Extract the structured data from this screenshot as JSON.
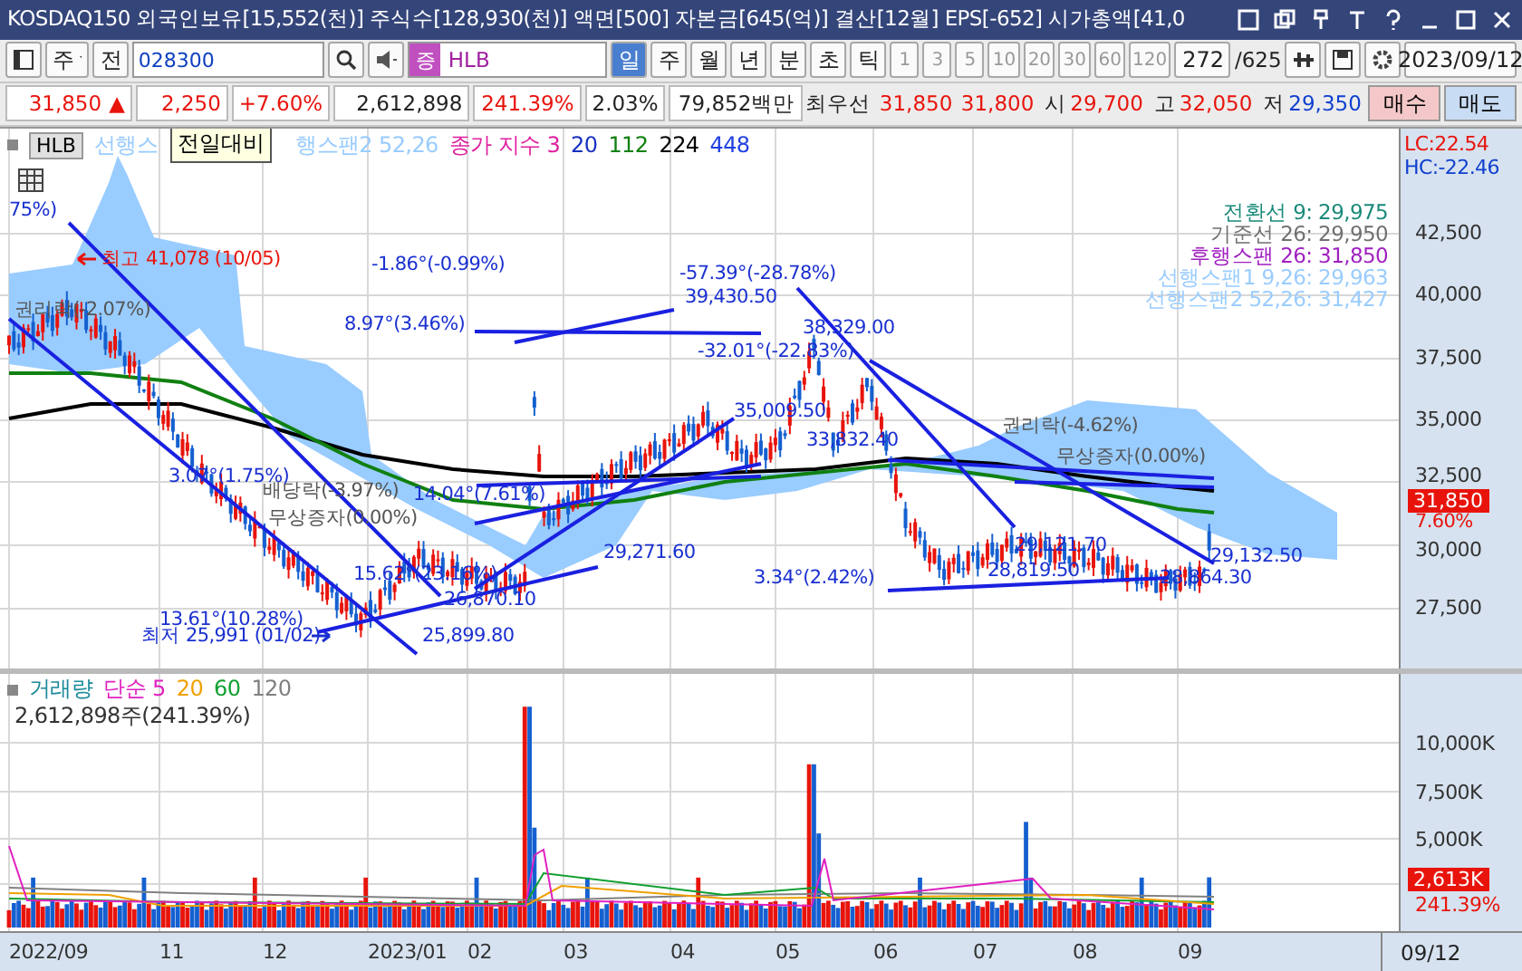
{
  "title_bar": {
    "title": "KOSDAQ150 외국인보유[15,552(천)] 주식수[128,930(천)] 액면[500] 자본금[645(억)] 결산[12월] EPS[-652] 시가총액[41,0"
  },
  "toolbar": {
    "market": "주",
    "prev_button": "전",
    "code": "028300",
    "stock_badge": "증",
    "stock_name": "HLB",
    "periods": [
      {
        "label": "일",
        "selected": true
      },
      {
        "label": "주",
        "selected": false
      },
      {
        "label": "월",
        "selected": false
      },
      {
        "label": "년",
        "selected": false
      }
    ],
    "intraday": [
      "분",
      "초",
      "틱"
    ],
    "minutes": [
      "1",
      "3",
      "5",
      "10",
      "20",
      "30",
      "60",
      "120"
    ],
    "count": "272",
    "total": "/625",
    "date": "2023/09/12"
  },
  "quote": {
    "cells": [
      {
        "text": "31,850",
        "kind": "up",
        "arrow": "▲"
      },
      {
        "text": "2,250",
        "kind": "up"
      },
      {
        "text": "+7.60%",
        "kind": "up"
      },
      {
        "text": "2,612,898",
        "kind": "plain"
      },
      {
        "text": "241.39%",
        "kind": "up"
      },
      {
        "text": "2.03%",
        "kind": "plain"
      },
      {
        "text": "79,852백만",
        "kind": "plain"
      }
    ],
    "best_label": "최우선",
    "ask": "31,850",
    "bid": "31,800",
    "ohl": [
      {
        "label": "시",
        "value": "29,700",
        "kind": "up"
      },
      {
        "label": "고",
        "value": "32,050",
        "kind": "up"
      },
      {
        "label": "저",
        "value": "29,350",
        "kind": "down"
      }
    ],
    "buy": "매수",
    "sell": "매도"
  },
  "price_chart": {
    "stock": "HLB",
    "tooltip": "전일대비",
    "legend": [
      {
        "text": "선행스",
        "color": "#99ccff"
      },
      {
        "text": "행스팬2 52,26",
        "color": "#99ccff"
      },
      {
        "text": "종가 지수 3",
        "color": "#e020a0"
      },
      {
        "text": "20",
        "color": "#1830c0"
      },
      {
        "text": "112",
        "color": "#108010"
      },
      {
        "text": "224",
        "color": "#000000"
      },
      {
        "text": "448",
        "color": "#2040e0"
      }
    ],
    "info": [
      {
        "text": "전환선 9: 29,975",
        "color": "#1a8a7a"
      },
      {
        "text": "기준선 26: 29,950",
        "color": "#707070"
      },
      {
        "text": "후행스팬 26: 31,850",
        "color": "#a020c0"
      },
      {
        "text": "선행스팬1 9,26: 29,963",
        "color": "#99ccff"
      },
      {
        "text": "선행스팬2 52,26: 31,427",
        "color": "#99ccff"
      }
    ],
    "lc": "LC:22.54",
    "hc": "HC:-22.46",
    "yticks": [
      "42,500",
      "40,000",
      "37,500",
      "35,000",
      "32,500",
      "30,000",
      "27,500"
    ],
    "last_price": "31,850",
    "last_pct": "7.60%",
    "annotations": [
      {
        "text": "75%)",
        "kind": "line"
      },
      {
        "text": "최고 41,078 (10/05)",
        "kind": "high"
      },
      {
        "text": "권리락(-2.07%)",
        "kind": "event"
      },
      {
        "text": "-1.86°(-0.99%)",
        "kind": "line"
      },
      {
        "text": "8.97°(3.46%)",
        "kind": "line"
      },
      {
        "text": "-57.39°(-28.78%)",
        "kind": "line"
      },
      {
        "text": "39,430.50",
        "kind": "line"
      },
      {
        "text": "38,329.00",
        "kind": "line"
      },
      {
        "text": "-32.01°(-22.83%)",
        "kind": "line"
      },
      {
        "text": "35,009.50",
        "kind": "line"
      },
      {
        "text": "33,832.40",
        "kind": "line"
      },
      {
        "text": "3.07°(1.75%)",
        "kind": "line"
      },
      {
        "text": "배당락(-3.97%)",
        "kind": "event"
      },
      {
        "text": "14.04°(7.61%)",
        "kind": "line"
      },
      {
        "text": "무상증자(0.00%)",
        "kind": "event"
      },
      {
        "text": "29,271.60",
        "kind": "line"
      },
      {
        "text": "15.62°(23.16%)",
        "kind": "line"
      },
      {
        "text": "26,870.10",
        "kind": "line"
      },
      {
        "text": "13.61°(10.28%)",
        "kind": "line"
      },
      {
        "text": "최저 25,991 (01/02)",
        "kind": "low"
      },
      {
        "text": "25,899.80",
        "kind": "line"
      },
      {
        "text": "권리락(-4.62%)",
        "kind": "event"
      },
      {
        "text": "무상증자(0.00%)",
        "kind": "event"
      },
      {
        "text": "3.34°(2.42%)",
        "kind": "line"
      },
      {
        "text": "29,121.70",
        "kind": "line"
      },
      {
        "text": "28,819.50",
        "kind": "line"
      },
      {
        "text": "29,132.50",
        "kind": "line"
      },
      {
        "text": "28,864.30",
        "kind": "line"
      }
    ]
  },
  "volume_chart": {
    "legend": [
      {
        "text": "거래량",
        "color": "#1a8a9a"
      },
      {
        "text": "단순 5",
        "color": "#e020c0"
      },
      {
        "text": "20",
        "color": "#f0a000"
      },
      {
        "text": "60",
        "color": "#10a030"
      },
      {
        "text": "120",
        "color": "#808080"
      }
    ],
    "reading": "2,612,898주(241.39%)",
    "yticks": [
      "10,000K",
      "7,500K",
      "5,000K"
    ],
    "last_volume": "2,613K",
    "last_pct": "241.39%"
  },
  "date_axis": {
    "labels": [
      "2022/09",
      "11",
      "12",
      "2023/01",
      "02",
      "03",
      "04",
      "05",
      "06",
      "07",
      "08",
      "09"
    ],
    "current": "09/12"
  }
}
